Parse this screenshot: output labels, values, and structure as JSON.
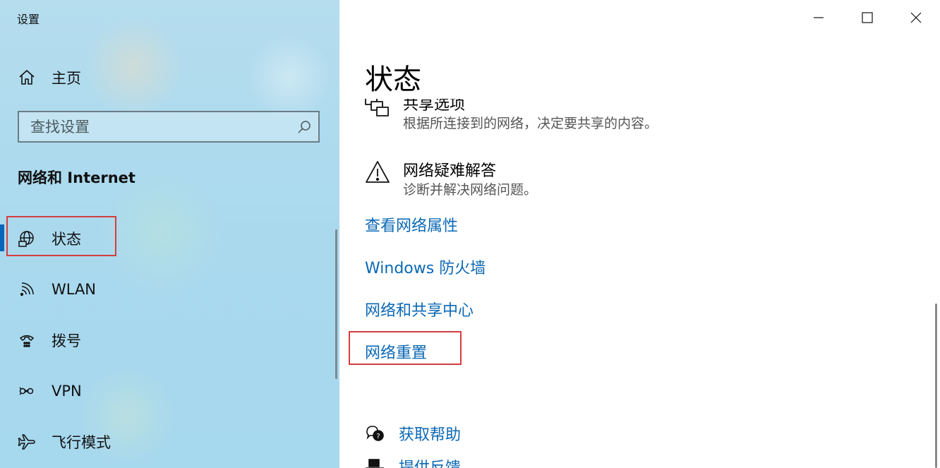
{
  "app": {
    "title": "设置"
  },
  "sidebar": {
    "home_label": "主页",
    "search_placeholder": "查找设置",
    "section_title": "网络和 Internet",
    "items": [
      {
        "label": "状态",
        "icon": "globe-icon",
        "active": true
      },
      {
        "label": "WLAN",
        "icon": "wifi-icon"
      },
      {
        "label": "拨号",
        "icon": "dialup-icon"
      },
      {
        "label": "VPN",
        "icon": "vpn-icon"
      },
      {
        "label": "飞行模式",
        "icon": "airplane-icon"
      }
    ]
  },
  "window_controls": {
    "minimize": "minimize-icon",
    "maximize": "maximize-icon",
    "close": "close-icon"
  },
  "content": {
    "title": "状态",
    "options": [
      {
        "title": "共享选项",
        "desc": "根据所连接到的网络，决定要共享的内容。",
        "icon": "sharing-icon"
      },
      {
        "title": "网络疑难解答",
        "desc": "诊断并解决网络问题。",
        "icon": "warning-icon"
      }
    ],
    "links": [
      "查看网络属性",
      "Windows 防火墙",
      "网络和共享中心",
      "网络重置"
    ],
    "help": [
      {
        "label": "获取帮助",
        "icon": "help-chat-icon"
      },
      {
        "label": "提供反馈",
        "icon": "feedback-icon"
      }
    ]
  },
  "colors": {
    "accent": "#0b68b5",
    "highlight": "#d63d3d",
    "active_bar": "#0a64b8"
  }
}
